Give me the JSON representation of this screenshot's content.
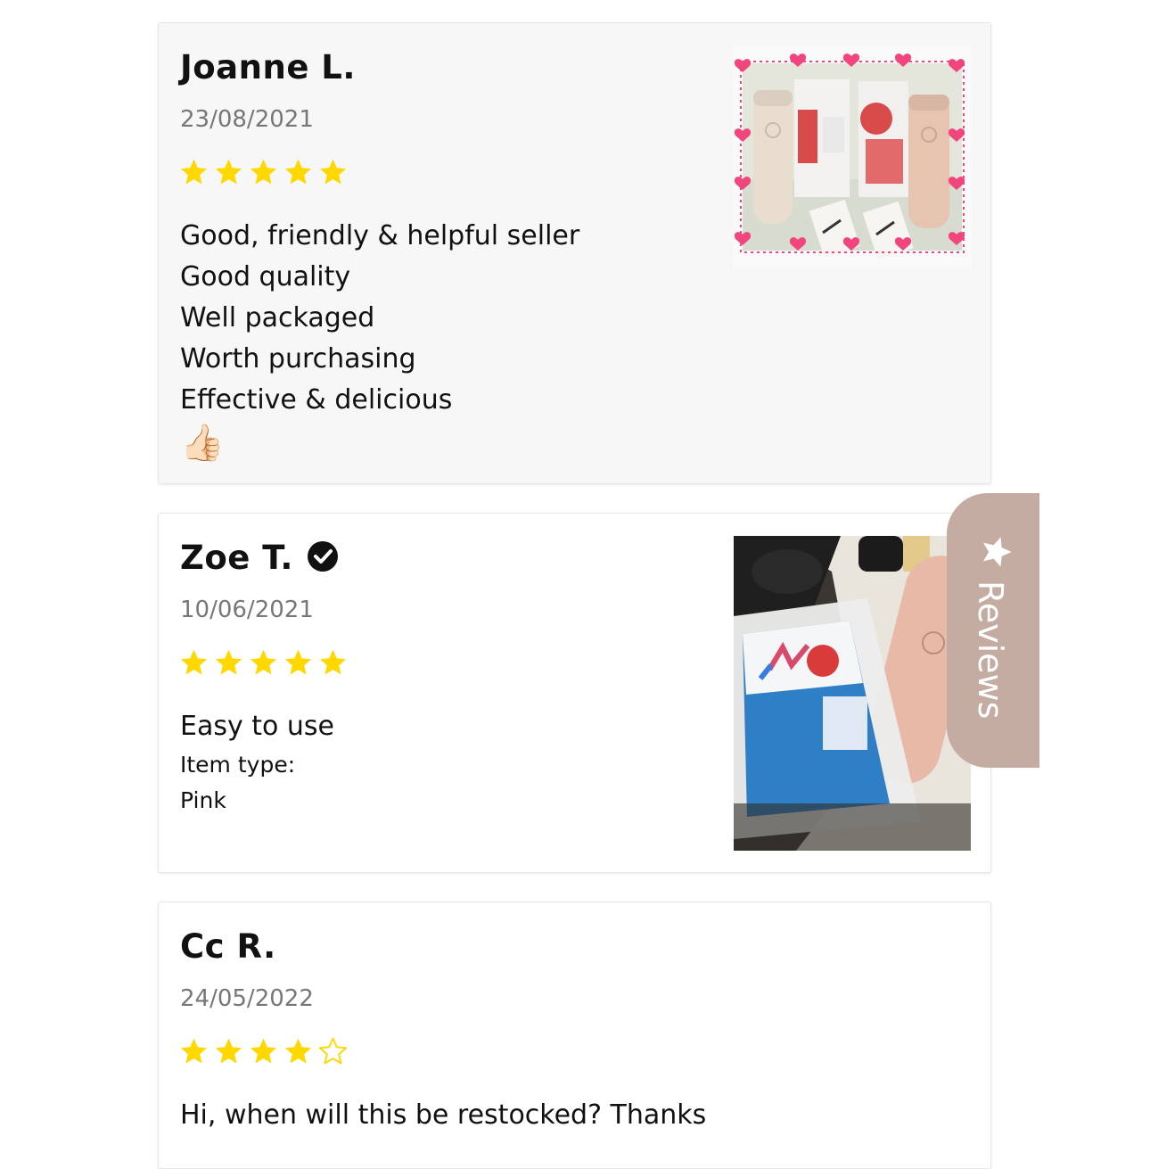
{
  "reviews": [
    {
      "name": "Joanne L.",
      "date": "23/08/2021",
      "rating": 5,
      "lines": [
        "Good, friendly & helpful seller",
        "Good quality",
        "Well packaged",
        "Worth purchasing",
        "Effective & delicious"
      ],
      "emoji": "👍🏻",
      "photo_alt": "thermos flasks and soup packets with heart border"
    },
    {
      "name": "Zoe T.",
      "verified": true,
      "date": "10/06/2021",
      "rating": 5,
      "text": "Easy to use",
      "item_type_label": "Item type:",
      "item_type_value": "Pink",
      "photo_alt": "soup packet next to pink flask"
    },
    {
      "name": "Cc R.",
      "date": "24/05/2022",
      "rating": 4,
      "text": "Hi, when will this be restocked? Thanks"
    }
  ],
  "reviews_tab": {
    "label": "Reviews",
    "icon": "star-icon"
  },
  "colors": {
    "star": "#ffd800",
    "tab": "#c4aca2",
    "date": "#777777",
    "card_alt_bg": "#f7f7f7"
  }
}
